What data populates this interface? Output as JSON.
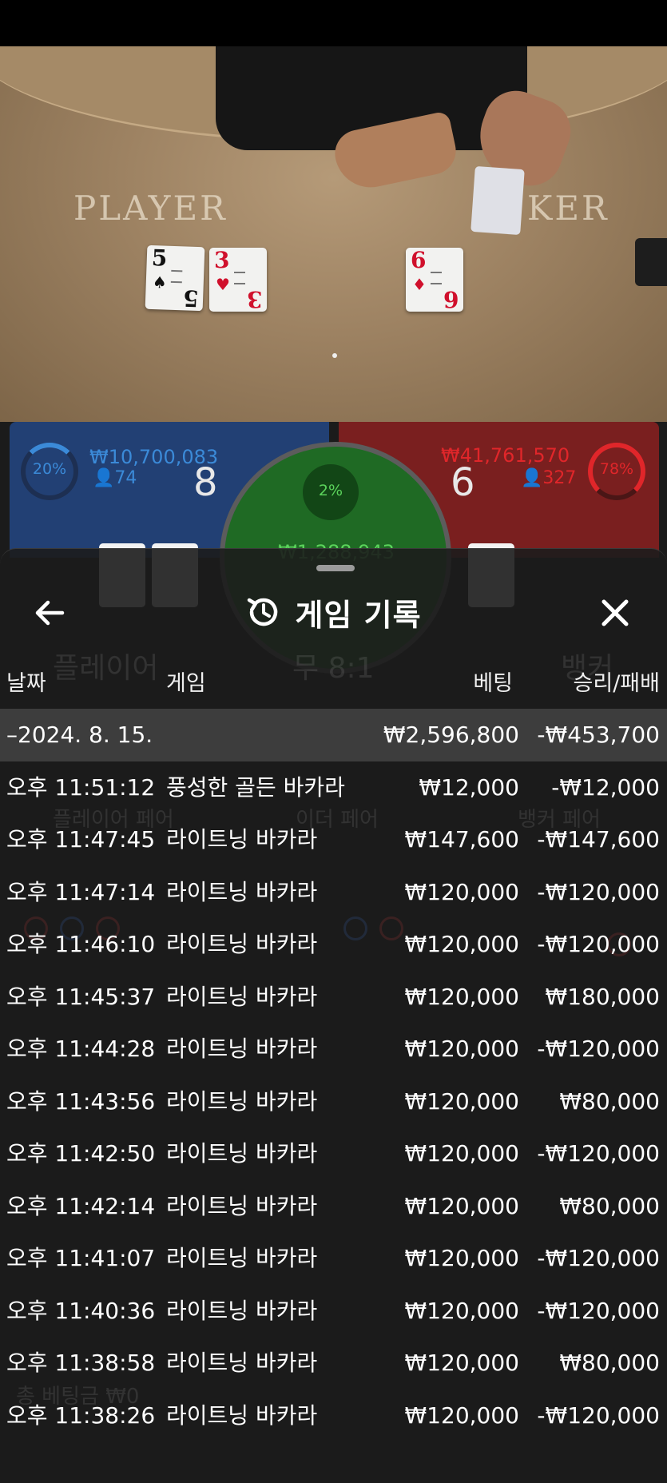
{
  "video": {
    "player_label": "PLAYER",
    "banker_label_partial": "KER",
    "player_cards": [
      {
        "rank": "5",
        "suit": "♠",
        "color": "black"
      },
      {
        "rank": "3",
        "suit": "♥",
        "color": "red"
      }
    ],
    "banker_cards": [
      {
        "rank": "6",
        "suit": "♦",
        "color": "red"
      }
    ]
  },
  "bet_panel": {
    "player": {
      "percent": "20%",
      "amount": "₩10,700,083",
      "players": "74",
      "score": "8",
      "color": "#224074"
    },
    "tie": {
      "percent": "2%",
      "amount": "₩1,288,943",
      "color": "#1f6a24"
    },
    "banker": {
      "percent": "78%",
      "amount": "₩41,761,570",
      "players": "327",
      "score": "6",
      "color": "#7a1f1f"
    }
  },
  "sheet": {
    "title": "게임 기록",
    "icons": {
      "back": "arrow-left-icon",
      "history": "history-icon",
      "close": "close-icon"
    },
    "columns": {
      "date": "날짜",
      "game": "게임",
      "bet": "베팅",
      "result": "승리/패배"
    },
    "summary": {
      "date": "–2024. 8. 15.",
      "bet": "₩2,596,800",
      "result": "-₩453,700"
    },
    "rows": [
      {
        "time": "오후 11:51:12",
        "game": "풍성한 골든 바카라",
        "bet": "₩12,000",
        "result": "-₩12,000"
      },
      {
        "time": "오후 11:47:45",
        "game": "라이트닝 바카라",
        "bet": "₩147,600",
        "result": "-₩147,600"
      },
      {
        "time": "오후 11:47:14",
        "game": "라이트닝 바카라",
        "bet": "₩120,000",
        "result": "-₩120,000"
      },
      {
        "time": "오후 11:46:10",
        "game": "라이트닝 바카라",
        "bet": "₩120,000",
        "result": "-₩120,000"
      },
      {
        "time": "오후 11:45:37",
        "game": "라이트닝 바카라",
        "bet": "₩120,000",
        "result": "₩180,000"
      },
      {
        "time": "오후 11:44:28",
        "game": "라이트닝 바카라",
        "bet": "₩120,000",
        "result": "-₩120,000"
      },
      {
        "time": "오후 11:43:56",
        "game": "라이트닝 바카라",
        "bet": "₩120,000",
        "result": "₩80,000"
      },
      {
        "time": "오후 11:42:50",
        "game": "라이트닝 바카라",
        "bet": "₩120,000",
        "result": "-₩120,000"
      },
      {
        "time": "오후 11:42:14",
        "game": "라이트닝 바카라",
        "bet": "₩120,000",
        "result": "₩80,000"
      },
      {
        "time": "오후 11:41:07",
        "game": "라이트닝 바카라",
        "bet": "₩120,000",
        "result": "-₩120,000"
      },
      {
        "time": "오후 11:40:36",
        "game": "라이트닝 바카라",
        "bet": "₩120,000",
        "result": "-₩120,000"
      },
      {
        "time": "오후 11:38:58",
        "game": "라이트닝 바카라",
        "bet": "₩120,000",
        "result": "₩80,000"
      },
      {
        "time": "오후 11:38:26",
        "game": "라이트닝 바카라",
        "bet": "₩120,000",
        "result": "-₩120,000"
      }
    ]
  },
  "background_text": {
    "player_label": "플레이어",
    "tie_label": "무 8:1",
    "banker_label": "뱅커",
    "player_pair": "플레이어 페어",
    "either_pair": "이더 페어",
    "banker_pair": "뱅커 페어",
    "bet_total": "총 베팅금 ₩0"
  }
}
